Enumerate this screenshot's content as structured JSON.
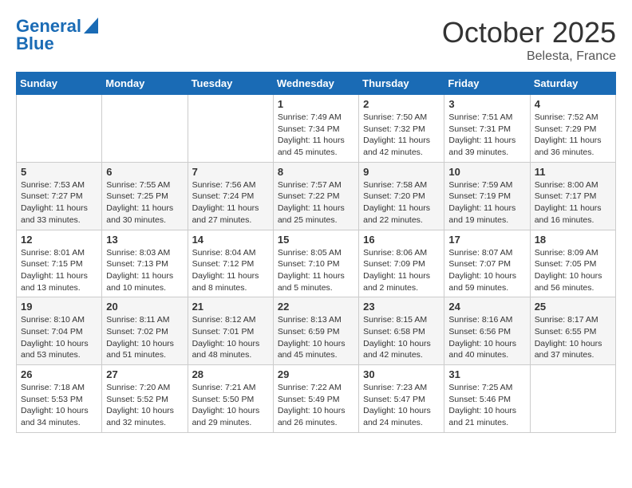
{
  "header": {
    "logo_line1": "General",
    "logo_line2": "Blue",
    "month": "October 2025",
    "location": "Belesta, France"
  },
  "weekdays": [
    "Sunday",
    "Monday",
    "Tuesday",
    "Wednesday",
    "Thursday",
    "Friday",
    "Saturday"
  ],
  "weeks": [
    [
      {
        "day": "",
        "info": ""
      },
      {
        "day": "",
        "info": ""
      },
      {
        "day": "",
        "info": ""
      },
      {
        "day": "1",
        "info": "Sunrise: 7:49 AM\nSunset: 7:34 PM\nDaylight: 11 hours and 45 minutes."
      },
      {
        "day": "2",
        "info": "Sunrise: 7:50 AM\nSunset: 7:32 PM\nDaylight: 11 hours and 42 minutes."
      },
      {
        "day": "3",
        "info": "Sunrise: 7:51 AM\nSunset: 7:31 PM\nDaylight: 11 hours and 39 minutes."
      },
      {
        "day": "4",
        "info": "Sunrise: 7:52 AM\nSunset: 7:29 PM\nDaylight: 11 hours and 36 minutes."
      }
    ],
    [
      {
        "day": "5",
        "info": "Sunrise: 7:53 AM\nSunset: 7:27 PM\nDaylight: 11 hours and 33 minutes."
      },
      {
        "day": "6",
        "info": "Sunrise: 7:55 AM\nSunset: 7:25 PM\nDaylight: 11 hours and 30 minutes."
      },
      {
        "day": "7",
        "info": "Sunrise: 7:56 AM\nSunset: 7:24 PM\nDaylight: 11 hours and 27 minutes."
      },
      {
        "day": "8",
        "info": "Sunrise: 7:57 AM\nSunset: 7:22 PM\nDaylight: 11 hours and 25 minutes."
      },
      {
        "day": "9",
        "info": "Sunrise: 7:58 AM\nSunset: 7:20 PM\nDaylight: 11 hours and 22 minutes."
      },
      {
        "day": "10",
        "info": "Sunrise: 7:59 AM\nSunset: 7:19 PM\nDaylight: 11 hours and 19 minutes."
      },
      {
        "day": "11",
        "info": "Sunrise: 8:00 AM\nSunset: 7:17 PM\nDaylight: 11 hours and 16 minutes."
      }
    ],
    [
      {
        "day": "12",
        "info": "Sunrise: 8:01 AM\nSunset: 7:15 PM\nDaylight: 11 hours and 13 minutes."
      },
      {
        "day": "13",
        "info": "Sunrise: 8:03 AM\nSunset: 7:13 PM\nDaylight: 11 hours and 10 minutes."
      },
      {
        "day": "14",
        "info": "Sunrise: 8:04 AM\nSunset: 7:12 PM\nDaylight: 11 hours and 8 minutes."
      },
      {
        "day": "15",
        "info": "Sunrise: 8:05 AM\nSunset: 7:10 PM\nDaylight: 11 hours and 5 minutes."
      },
      {
        "day": "16",
        "info": "Sunrise: 8:06 AM\nSunset: 7:09 PM\nDaylight: 11 hours and 2 minutes."
      },
      {
        "day": "17",
        "info": "Sunrise: 8:07 AM\nSunset: 7:07 PM\nDaylight: 10 hours and 59 minutes."
      },
      {
        "day": "18",
        "info": "Sunrise: 8:09 AM\nSunset: 7:05 PM\nDaylight: 10 hours and 56 minutes."
      }
    ],
    [
      {
        "day": "19",
        "info": "Sunrise: 8:10 AM\nSunset: 7:04 PM\nDaylight: 10 hours and 53 minutes."
      },
      {
        "day": "20",
        "info": "Sunrise: 8:11 AM\nSunset: 7:02 PM\nDaylight: 10 hours and 51 minutes."
      },
      {
        "day": "21",
        "info": "Sunrise: 8:12 AM\nSunset: 7:01 PM\nDaylight: 10 hours and 48 minutes."
      },
      {
        "day": "22",
        "info": "Sunrise: 8:13 AM\nSunset: 6:59 PM\nDaylight: 10 hours and 45 minutes."
      },
      {
        "day": "23",
        "info": "Sunrise: 8:15 AM\nSunset: 6:58 PM\nDaylight: 10 hours and 42 minutes."
      },
      {
        "day": "24",
        "info": "Sunrise: 8:16 AM\nSunset: 6:56 PM\nDaylight: 10 hours and 40 minutes."
      },
      {
        "day": "25",
        "info": "Sunrise: 8:17 AM\nSunset: 6:55 PM\nDaylight: 10 hours and 37 minutes."
      }
    ],
    [
      {
        "day": "26",
        "info": "Sunrise: 7:18 AM\nSunset: 5:53 PM\nDaylight: 10 hours and 34 minutes."
      },
      {
        "day": "27",
        "info": "Sunrise: 7:20 AM\nSunset: 5:52 PM\nDaylight: 10 hours and 32 minutes."
      },
      {
        "day": "28",
        "info": "Sunrise: 7:21 AM\nSunset: 5:50 PM\nDaylight: 10 hours and 29 minutes."
      },
      {
        "day": "29",
        "info": "Sunrise: 7:22 AM\nSunset: 5:49 PM\nDaylight: 10 hours and 26 minutes."
      },
      {
        "day": "30",
        "info": "Sunrise: 7:23 AM\nSunset: 5:47 PM\nDaylight: 10 hours and 24 minutes."
      },
      {
        "day": "31",
        "info": "Sunrise: 7:25 AM\nSunset: 5:46 PM\nDaylight: 10 hours and 21 minutes."
      },
      {
        "day": "",
        "info": ""
      }
    ]
  ]
}
